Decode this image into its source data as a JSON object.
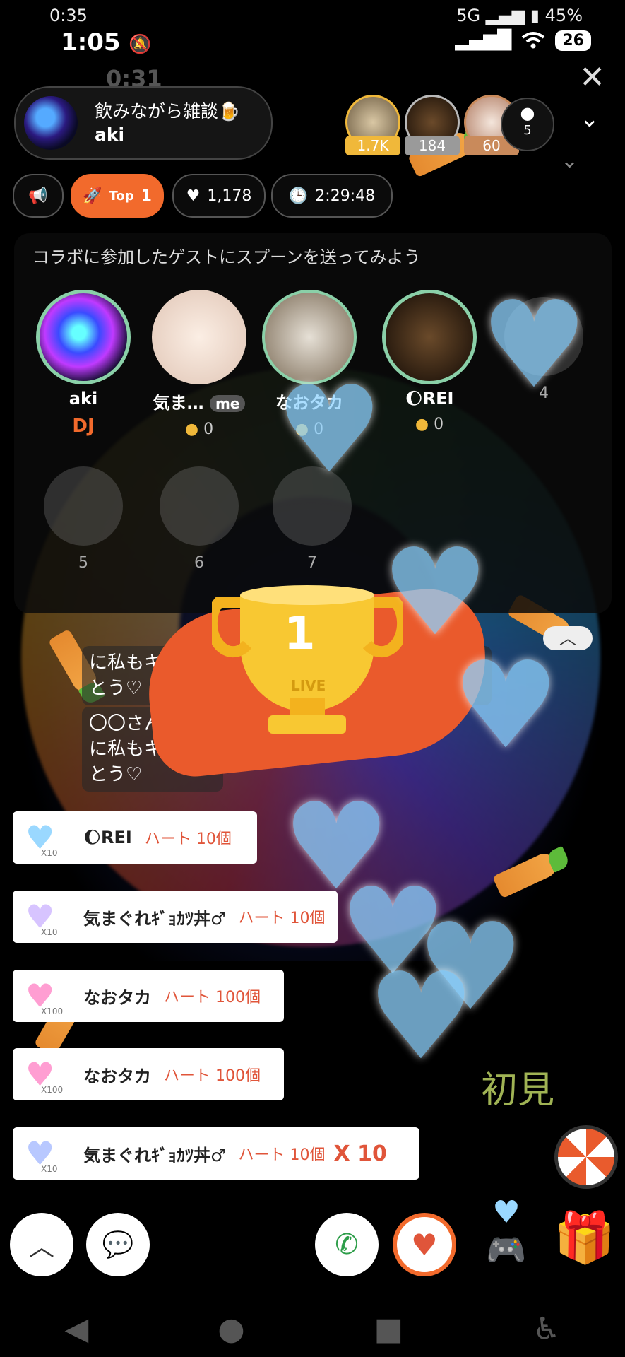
{
  "status_old": {
    "time": "0:35",
    "battery": "45%",
    "network": "5G"
  },
  "status": {
    "time": "1:05",
    "battery": "26"
  },
  "ghost_time": "0:31",
  "room": {
    "title": "飲みながら雑談🍺",
    "host": "aki"
  },
  "top_supporters": [
    {
      "count": "1.7K",
      "color": "#f0b83a"
    },
    {
      "count": "184",
      "color": "#b9b9b9"
    },
    {
      "count": "60",
      "color": "#c98a5b"
    }
  ],
  "listeners": "5",
  "pills": {
    "top_label": "Top",
    "top_rank": "1",
    "hearts": "1,178",
    "duration": "2:29:48"
  },
  "collab": {
    "title": "コラボに参加したゲストにスプーンを送ってみよう",
    "guests": [
      {
        "name": "aki",
        "badge": "DJ"
      },
      {
        "name": "気ま…",
        "tag": "me",
        "spoons": "0"
      },
      {
        "name": "なおタカ",
        "spoons": "0"
      },
      {
        "name": "🌔REI",
        "spoons": "0"
      }
    ],
    "empty_slots": [
      "4",
      "5",
      "6",
      "7"
    ]
  },
  "chat": {
    "msg1_line1": "に私もキュン",
    "msg1_line2": "とう♡",
    "msg2_line1": "〇〇さん",
    "msg2_line2": "に私もキ",
    "msg2_line3": "とう♡"
  },
  "trophy": {
    "rank": "1",
    "label": "LIVE"
  },
  "gifts": [
    {
      "name": "🌔REI",
      "item": "ハート 10個",
      "count_label": "X10"
    },
    {
      "name": "気まぐれｷﾞｮｶﾂ丼♂",
      "item": "ハート 10個",
      "count_label": "X10"
    },
    {
      "name": "なおタカ",
      "item": "ハート 100個",
      "count_label": "X100"
    },
    {
      "name": "なおタカ",
      "item": "ハート 100個",
      "count_label": "X100"
    },
    {
      "name": "気まぐれｷﾞｮｶﾂ丼♂",
      "item": "ハート 10個",
      "count_label": "X10",
      "multiplier": "X 10"
    }
  ],
  "overlay_text": "初見",
  "icons": {
    "close": "close-icon",
    "megaphone": "megaphone-icon",
    "rocket": "rocket-icon",
    "heart": "heart-icon",
    "clock": "clock-icon",
    "phone": "phone-icon",
    "chat": "chat-bubble-icon"
  }
}
